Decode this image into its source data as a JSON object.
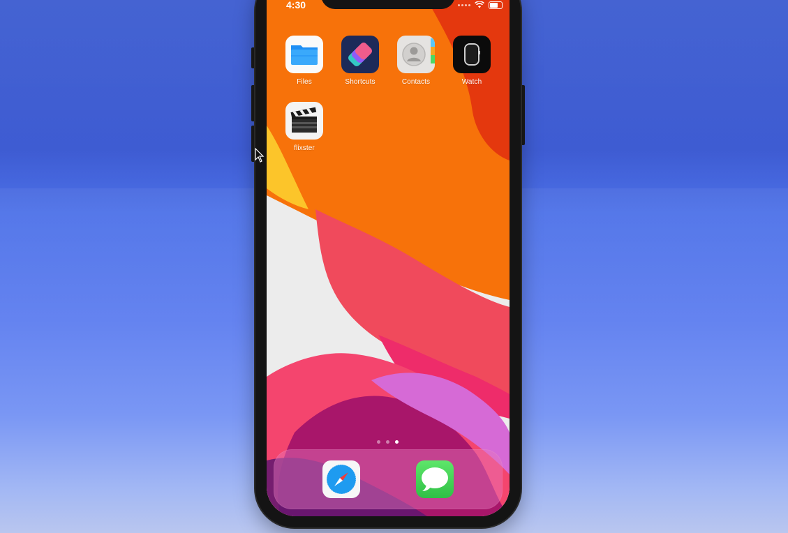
{
  "status_bar": {
    "time": "4:30"
  },
  "home": {
    "apps": [
      {
        "label": "Files",
        "icon": "folder-icon"
      },
      {
        "label": "Shortcuts",
        "icon": "shortcuts-icon"
      },
      {
        "label": "Contacts",
        "icon": "contacts-icon"
      },
      {
        "label": "Watch",
        "icon": "watch-icon"
      },
      {
        "label": "flixster",
        "icon": "clapperboard-icon"
      }
    ],
    "page_indicator": {
      "pages": 3,
      "current": 3
    }
  },
  "dock": {
    "apps": [
      {
        "label": "Safari",
        "icon": "safari-compass-icon"
      },
      {
        "label": "Messages",
        "icon": "message-bubble-icon"
      }
    ]
  },
  "colors": {
    "background_blue": "#4e72e8",
    "wallpaper_orange": "#f7720a",
    "wallpaper_red": "#f04a5c",
    "wallpaper_magenta": "#c2136e",
    "wallpaper_purple": "#d66ad6",
    "messages_green": "#34c759",
    "safari_blue": "#1e9bf0"
  }
}
